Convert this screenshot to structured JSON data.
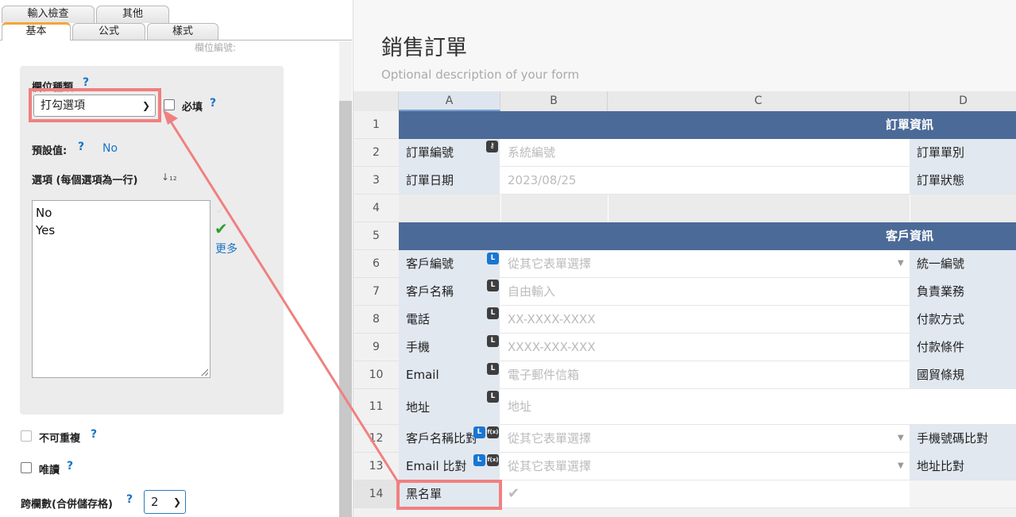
{
  "panel": {
    "tabs_row1": [
      "輸入檢查",
      "其他"
    ],
    "tabs_row2": [
      "基本",
      "公式",
      "樣式"
    ],
    "field_number_label": "欄位編號:",
    "field_type_label": "欄位種類",
    "field_type_value": "打勾選項",
    "required_label": "必填",
    "default_label": "預設值:",
    "default_value": "No",
    "options_label": "選項 (每個選項為一行)",
    "options": [
      "No",
      "Yes"
    ],
    "more_label": "更多",
    "unique_label": "不可重複",
    "readonly_label": "唯讀",
    "colspan_label": "跨欄數(合併儲存格)",
    "colspan_value": "2",
    "help_glyph": "?"
  },
  "sheet": {
    "title": "銷售訂單",
    "description": "Optional description of your form",
    "columns": [
      "A",
      "B",
      "C",
      "D"
    ],
    "row_numbers": [
      "1",
      "2",
      "3",
      "4",
      "5",
      "6",
      "7",
      "8",
      "9",
      "10",
      "11",
      "12",
      "13",
      "14"
    ],
    "section_order_info": "訂單資訊",
    "section_customer_info": "客戶資訊",
    "rows": {
      "r2": {
        "label": "訂單編號",
        "placeholder": "系統編號",
        "right_label": "訂單單別"
      },
      "r3": {
        "label": "訂單日期",
        "placeholder": "2023/08/25",
        "right_label": "訂單狀態"
      },
      "r6": {
        "label": "客戶編號",
        "placeholder": "從其它表單選擇",
        "right_label": "統一編號"
      },
      "r7": {
        "label": "客戶名稱",
        "placeholder": "自由輸入",
        "right_label": "負責業務"
      },
      "r8": {
        "label": "電話",
        "placeholder": "XX-XXXX-XXXX",
        "right_label": "付款方式"
      },
      "r9": {
        "label": "手機",
        "placeholder": "XXXX-XXX-XXX",
        "right_label": "付款條件"
      },
      "r10": {
        "label": "Email",
        "placeholder": "電子郵件信箱",
        "right_label": "國貿條規"
      },
      "r11": {
        "label": "地址",
        "placeholder": "地址"
      },
      "r12": {
        "label": "客戶名稱比對",
        "placeholder": "從其它表單選擇",
        "right_label": "手機號碼比對"
      },
      "r13": {
        "label": "Email 比對",
        "placeholder": "從其它表單選擇",
        "right_label": "地址比對"
      },
      "r14": {
        "label": "黑名單"
      }
    },
    "badge_L": "L",
    "badge_fx": "f(x)"
  },
  "colors": {
    "section_header": "#4b6a97",
    "label_cell": "#e2e8f0",
    "highlight": "#f08080",
    "link": "#1a73c6",
    "confirm": "#2f9e2f"
  },
  "icons": [
    "key-icon",
    "lookup-badge-icon",
    "formula-badge-icon",
    "dropdown-caret-icon",
    "checkmark-icon",
    "help-icon",
    "sort-icon"
  ]
}
